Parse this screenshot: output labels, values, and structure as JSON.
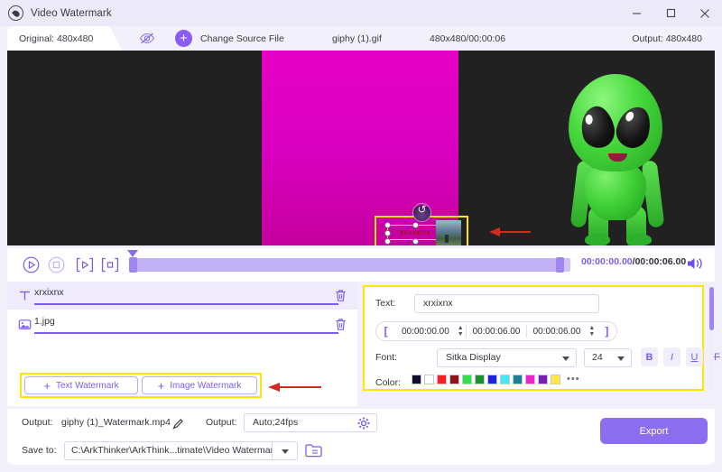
{
  "window": {
    "title": "Video Watermark",
    "logo_icon": "water-drop-icon",
    "minimize_icon": "minimize-icon",
    "maximize_icon": "maximize-icon",
    "close_icon": "close-icon"
  },
  "header": {
    "original_label": "Original: 480x480",
    "eye_icon": "eye-off-icon",
    "change_source_label": "Change Source File",
    "plus_icon": "plus-icon",
    "file_name": "giphy (1).gif",
    "dimensions_duration": "480x480/00:00:06",
    "output_label": "Output: 480x480"
  },
  "preview": {
    "watermark_text": "xrxixnx",
    "rotate_icon": "rotate-handle-icon",
    "image_thumb_name": "1.jpg",
    "background_color": "#212121",
    "video_color": "#e500c4",
    "highlight_color": "#ffe600",
    "arrow_color": "#d22b20"
  },
  "playback": {
    "play_icon": "play-circle-icon",
    "stop_icon": "stop-circle-icon",
    "set_in_icon": "set-start-point-icon",
    "set_out_icon": "set-end-point-icon",
    "current_time": "00:00:00.00",
    "time_separator": "/",
    "total_time": "00:00:06.00",
    "volume_icon": "volume-icon"
  },
  "watermark_list": {
    "items": [
      {
        "icon": "text-watermark-icon",
        "name": "xrxixnx",
        "delete_icon": "trash-icon",
        "selected": true
      },
      {
        "icon": "image-watermark-icon",
        "name": "1.jpg",
        "delete_icon": "trash-icon",
        "selected": false
      }
    ],
    "add_text_label": "Text Watermark",
    "add_image_label": "Image Watermark",
    "plus_glyph": "+"
  },
  "settings": {
    "text_label": "Text:",
    "text_value": "xrxixnx",
    "bracket_open": "[",
    "bracket_close": "]",
    "time_start": "00:00:00.00",
    "time_end": "00:00:06.00",
    "time_duration": "00:00:06.00",
    "font_label": "Font:",
    "font_value": "Sitka Display",
    "font_size_value": "24",
    "bold_label": "B",
    "italic_label": "I",
    "underline_label": "U",
    "strike_label": "F",
    "color_label": "Color:",
    "colors": [
      "#0d0d2b",
      "#ffffff",
      "#fa1f1f",
      "#8c1515",
      "#2fe24a",
      "#1f8f2a",
      "#2020e0",
      "#47e8f0",
      "#1f7f8c",
      "#f020d0",
      "#7a1fb5",
      "#ffe94a"
    ],
    "more_colors_glyph": "•••"
  },
  "bottom": {
    "output_name_label": "Output:",
    "output_name_value": "giphy (1)_Watermark.mp4",
    "edit_icon": "pencil-icon",
    "output_format_label": "Output:",
    "output_format_value": "Auto;24fps",
    "gear_icon": "gear-icon",
    "save_to_label": "Save to:",
    "save_to_value": "C:\\ArkThinker\\ArkThink...timate\\Video Watermark",
    "folder_icon": "folder-icon",
    "export_label": "Export"
  }
}
